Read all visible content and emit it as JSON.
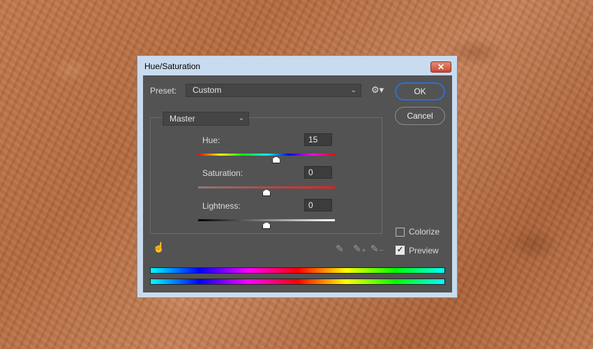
{
  "window": {
    "title": "Hue/Saturation",
    "close_label": "✕"
  },
  "preset": {
    "label": "Preset:",
    "value": "Custom"
  },
  "buttons": {
    "ok": "OK",
    "cancel": "Cancel"
  },
  "channel": {
    "value": "Master"
  },
  "hue": {
    "label": "Hue:",
    "value": "15",
    "slider_fraction": 0.57
  },
  "saturation": {
    "label": "Saturation:",
    "value": "0",
    "slider_fraction": 0.5
  },
  "lightness": {
    "label": "Lightness:",
    "value": "0",
    "slider_fraction": 0.5
  },
  "options": {
    "colorize": {
      "label": "Colorize",
      "checked": false
    },
    "preview": {
      "label": "Preview",
      "checked": true
    }
  },
  "icons": {
    "gear": "gear-icon",
    "hand": "targeted-adjustment-icon",
    "eyedropper": "eyedropper-icon",
    "eyedropper_add": "eyedropper-plus-icon",
    "eyedropper_sub": "eyedropper-minus-icon"
  },
  "spectrum": {
    "top_colors": [
      "#00ffff",
      "#0000ff",
      "#ff00ff",
      "#ff0000",
      "#ffff00",
      "#00ff00",
      "#00ffff"
    ],
    "bottom_colors": [
      "#00ffff",
      "#0000ff",
      "#ff00ff",
      "#ff0000",
      "#ffff00",
      "#00ff00",
      "#00ffff"
    ]
  }
}
